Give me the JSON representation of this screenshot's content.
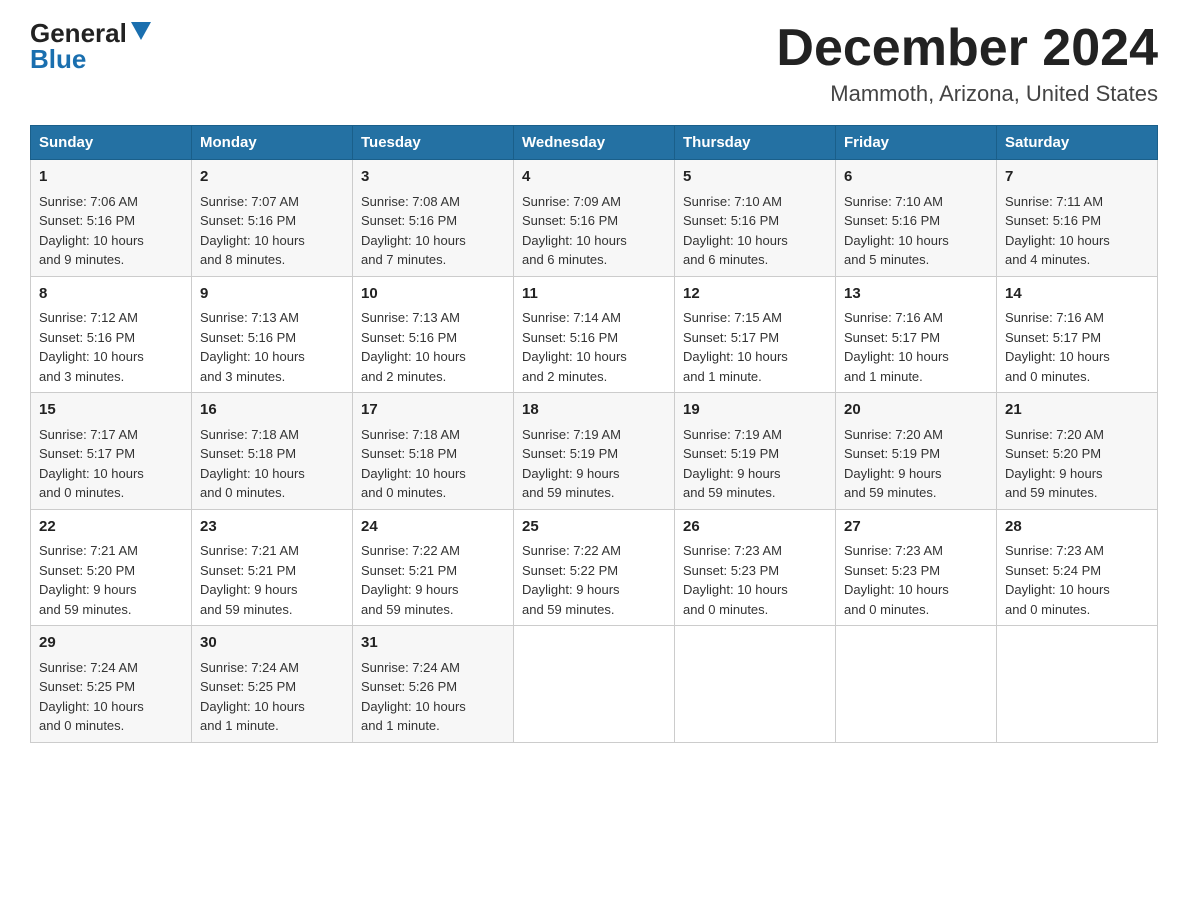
{
  "header": {
    "logo_general": "General",
    "logo_blue": "Blue",
    "month_title": "December 2024",
    "location": "Mammoth, Arizona, United States"
  },
  "days_of_week": [
    "Sunday",
    "Monday",
    "Tuesday",
    "Wednesday",
    "Thursday",
    "Friday",
    "Saturday"
  ],
  "weeks": [
    [
      {
        "day": "1",
        "info": "Sunrise: 7:06 AM\nSunset: 5:16 PM\nDaylight: 10 hours\nand 9 minutes."
      },
      {
        "day": "2",
        "info": "Sunrise: 7:07 AM\nSunset: 5:16 PM\nDaylight: 10 hours\nand 8 minutes."
      },
      {
        "day": "3",
        "info": "Sunrise: 7:08 AM\nSunset: 5:16 PM\nDaylight: 10 hours\nand 7 minutes."
      },
      {
        "day": "4",
        "info": "Sunrise: 7:09 AM\nSunset: 5:16 PM\nDaylight: 10 hours\nand 6 minutes."
      },
      {
        "day": "5",
        "info": "Sunrise: 7:10 AM\nSunset: 5:16 PM\nDaylight: 10 hours\nand 6 minutes."
      },
      {
        "day": "6",
        "info": "Sunrise: 7:10 AM\nSunset: 5:16 PM\nDaylight: 10 hours\nand 5 minutes."
      },
      {
        "day": "7",
        "info": "Sunrise: 7:11 AM\nSunset: 5:16 PM\nDaylight: 10 hours\nand 4 minutes."
      }
    ],
    [
      {
        "day": "8",
        "info": "Sunrise: 7:12 AM\nSunset: 5:16 PM\nDaylight: 10 hours\nand 3 minutes."
      },
      {
        "day": "9",
        "info": "Sunrise: 7:13 AM\nSunset: 5:16 PM\nDaylight: 10 hours\nand 3 minutes."
      },
      {
        "day": "10",
        "info": "Sunrise: 7:13 AM\nSunset: 5:16 PM\nDaylight: 10 hours\nand 2 minutes."
      },
      {
        "day": "11",
        "info": "Sunrise: 7:14 AM\nSunset: 5:16 PM\nDaylight: 10 hours\nand 2 minutes."
      },
      {
        "day": "12",
        "info": "Sunrise: 7:15 AM\nSunset: 5:17 PM\nDaylight: 10 hours\nand 1 minute."
      },
      {
        "day": "13",
        "info": "Sunrise: 7:16 AM\nSunset: 5:17 PM\nDaylight: 10 hours\nand 1 minute."
      },
      {
        "day": "14",
        "info": "Sunrise: 7:16 AM\nSunset: 5:17 PM\nDaylight: 10 hours\nand 0 minutes."
      }
    ],
    [
      {
        "day": "15",
        "info": "Sunrise: 7:17 AM\nSunset: 5:17 PM\nDaylight: 10 hours\nand 0 minutes."
      },
      {
        "day": "16",
        "info": "Sunrise: 7:18 AM\nSunset: 5:18 PM\nDaylight: 10 hours\nand 0 minutes."
      },
      {
        "day": "17",
        "info": "Sunrise: 7:18 AM\nSunset: 5:18 PM\nDaylight: 10 hours\nand 0 minutes."
      },
      {
        "day": "18",
        "info": "Sunrise: 7:19 AM\nSunset: 5:19 PM\nDaylight: 9 hours\nand 59 minutes."
      },
      {
        "day": "19",
        "info": "Sunrise: 7:19 AM\nSunset: 5:19 PM\nDaylight: 9 hours\nand 59 minutes."
      },
      {
        "day": "20",
        "info": "Sunrise: 7:20 AM\nSunset: 5:19 PM\nDaylight: 9 hours\nand 59 minutes."
      },
      {
        "day": "21",
        "info": "Sunrise: 7:20 AM\nSunset: 5:20 PM\nDaylight: 9 hours\nand 59 minutes."
      }
    ],
    [
      {
        "day": "22",
        "info": "Sunrise: 7:21 AM\nSunset: 5:20 PM\nDaylight: 9 hours\nand 59 minutes."
      },
      {
        "day": "23",
        "info": "Sunrise: 7:21 AM\nSunset: 5:21 PM\nDaylight: 9 hours\nand 59 minutes."
      },
      {
        "day": "24",
        "info": "Sunrise: 7:22 AM\nSunset: 5:21 PM\nDaylight: 9 hours\nand 59 minutes."
      },
      {
        "day": "25",
        "info": "Sunrise: 7:22 AM\nSunset: 5:22 PM\nDaylight: 9 hours\nand 59 minutes."
      },
      {
        "day": "26",
        "info": "Sunrise: 7:23 AM\nSunset: 5:23 PM\nDaylight: 10 hours\nand 0 minutes."
      },
      {
        "day": "27",
        "info": "Sunrise: 7:23 AM\nSunset: 5:23 PM\nDaylight: 10 hours\nand 0 minutes."
      },
      {
        "day": "28",
        "info": "Sunrise: 7:23 AM\nSunset: 5:24 PM\nDaylight: 10 hours\nand 0 minutes."
      }
    ],
    [
      {
        "day": "29",
        "info": "Sunrise: 7:24 AM\nSunset: 5:25 PM\nDaylight: 10 hours\nand 0 minutes."
      },
      {
        "day": "30",
        "info": "Sunrise: 7:24 AM\nSunset: 5:25 PM\nDaylight: 10 hours\nand 1 minute."
      },
      {
        "day": "31",
        "info": "Sunrise: 7:24 AM\nSunset: 5:26 PM\nDaylight: 10 hours\nand 1 minute."
      },
      null,
      null,
      null,
      null
    ]
  ]
}
